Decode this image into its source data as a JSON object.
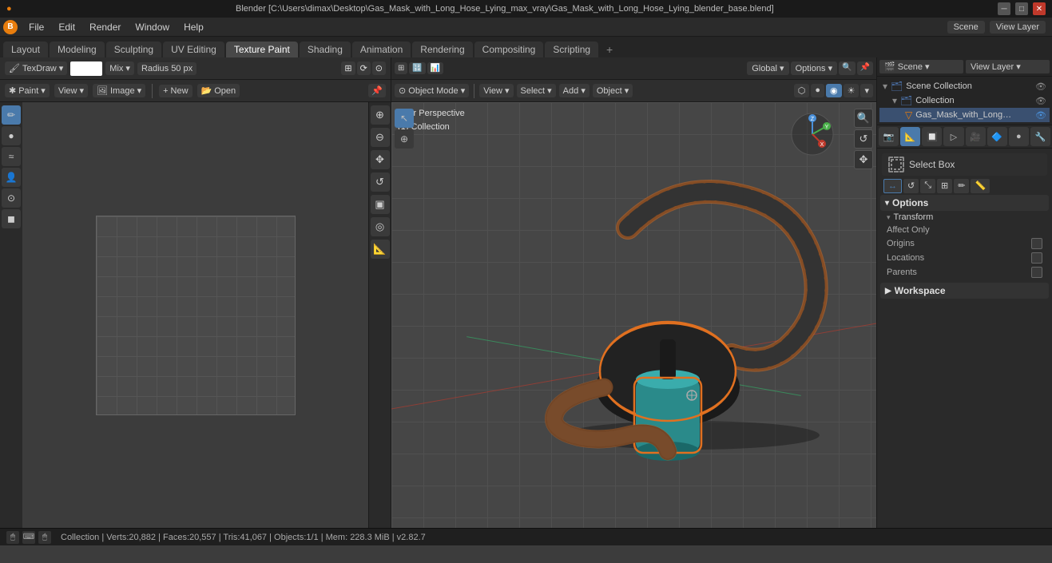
{
  "titlebar": {
    "title": "Blender [C:\\Users\\dimax\\Desktop\\Gas_Mask_with_Long_Hose_Lying_max_vray\\Gas_Mask_with_Long_Hose_Lying_blender_base.blend]",
    "min": "─",
    "max": "□",
    "close": "✕"
  },
  "menubar": {
    "logo": "B",
    "items": [
      "File",
      "Edit",
      "Render",
      "Window",
      "Help"
    ]
  },
  "workspace_tabs": {
    "tabs": [
      "Layout",
      "Modeling",
      "Sculpting",
      "UV Editing",
      "Texture Paint",
      "Shading",
      "Animation",
      "Rendering",
      "Compositing",
      "Scripting"
    ],
    "active": "Texture Paint",
    "add": "+"
  },
  "uv_toolbar": {
    "mode": "TexDraw",
    "color": "#ffffff",
    "blend": "Mix",
    "radius_label": "Radius",
    "radius_value": "50 px"
  },
  "uv_buttons": {
    "paint": "Paint",
    "view": "View",
    "image": "Image",
    "new": "New",
    "open": "Open"
  },
  "uv_tools": {
    "items": [
      "✏",
      "●",
      "≈",
      "👤",
      "⊙",
      "◼"
    ]
  },
  "uv_nav_tools": {
    "items": [
      "⊕",
      "↔",
      "✥",
      "↺",
      "▣",
      "◎",
      "✏",
      "📐"
    ]
  },
  "viewport_toolbar": {
    "object_mode": "Object Mode",
    "view": "View",
    "select": "Select",
    "add": "Add",
    "object": "Object"
  },
  "viewport_label": {
    "line1": "User Perspective",
    "line2": "(1) Collection"
  },
  "vp_top_toolbar": {
    "global": "Global",
    "options": "Options",
    "view_layer": "View Layer"
  },
  "right_panel": {
    "scene_label": "Scene",
    "view_layer_label": "View Layer",
    "scene_collection_label": "Scene Collection",
    "collection_label": "Collection",
    "object_label": "Gas_Mask_with_Long_Ho",
    "icons": [
      "📷",
      "📐",
      "🔲",
      "▷",
      "🎥",
      "🔷",
      "●",
      "🔧"
    ],
    "select_box_label": "Select Box",
    "options_label": "Options",
    "transform_label": "Transform",
    "affect_only_label": "Affect Only",
    "origins_label": "Origins",
    "locations_label": "Locations",
    "parents_label": "Parents",
    "workspace_label": "Workspace"
  },
  "statusbar": {
    "text": "Collection | Verts:20,882 | Faces:20,557 | Tris:41,067 | Objects:1/1 | Mem: 228.3 MiB | v2.82.7",
    "icon1": "🖱",
    "icon2": "⌨",
    "icon3": "🖱"
  }
}
